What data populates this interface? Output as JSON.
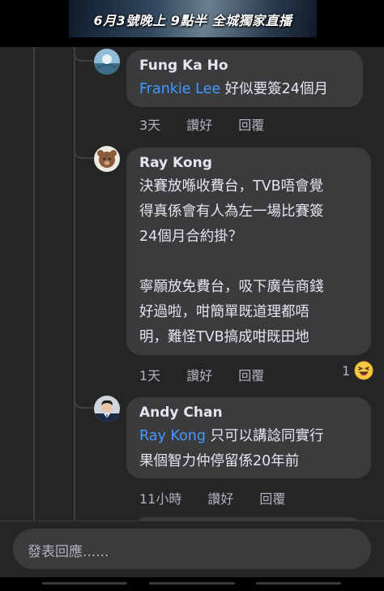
{
  "banner": {
    "text": "6月3號晚上 9點半 全城獨家直播"
  },
  "comments": [
    {
      "name": "Fung Ka Ho",
      "mention": "Frankie Lee",
      "text": " 好似要簽24個月",
      "time": "3天",
      "like": "讚好",
      "reply": "回覆"
    },
    {
      "name": "Ray Kong",
      "lines1": [
        "決賽放喺收費台，TVB唔會覺",
        "得真係會有人為左一場比賽簽",
        "24個月合約掛？"
      ],
      "lines2": [
        "寧願放免費台，吸下廣告商錢",
        "好過啦，咁簡單既道理都唔",
        "明，難怪TVB搞成咁既田地"
      ],
      "time": "1天",
      "like": "讚好",
      "reply": "回覆",
      "reaction_count": "1",
      "reaction_icon": "laughing-emoji-icon"
    },
    {
      "name": "Andy Chan",
      "mention": "Ray Kong",
      "text_line1": " 只可以講諗同實行",
      "text_line2": "果個智力仲停留係20年前",
      "time": "11小時",
      "like": "讚好",
      "reply": "回覆"
    }
  ],
  "composer": {
    "placeholder": "發表回應......"
  },
  "colors": {
    "background": "#242526",
    "bubble": "#3a3b3c",
    "mention": "#4599ff",
    "meta": "#b0b3b8"
  }
}
